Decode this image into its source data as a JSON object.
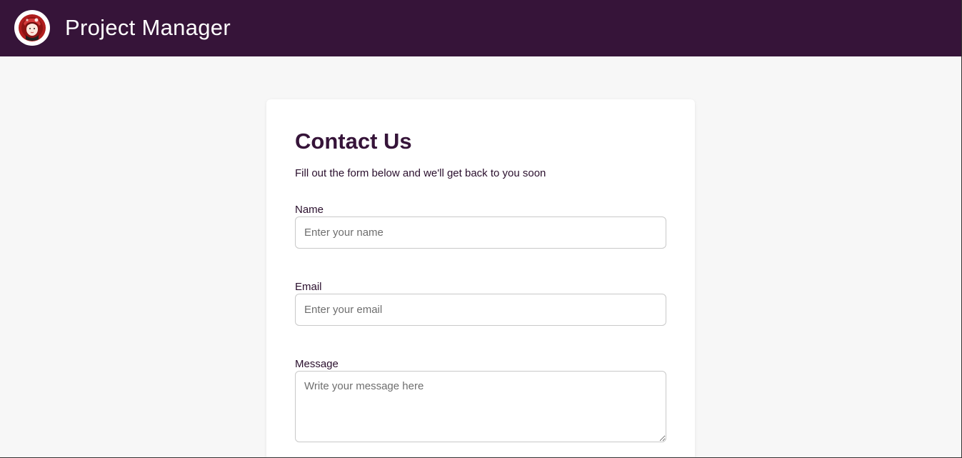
{
  "header": {
    "app_title": "Project Manager",
    "logo_icon": "avatar-logo-icon",
    "background_color": "#361439"
  },
  "contact_form": {
    "title": "Contact Us",
    "subtitle": "Fill out the form below and we'll get back to you soon",
    "fields": {
      "name": {
        "label": "Name",
        "placeholder": "Enter your name",
        "value": ""
      },
      "email": {
        "label": "Email",
        "placeholder": "Enter your email",
        "value": ""
      },
      "message": {
        "label": "Message",
        "placeholder": "Write your message here",
        "value": ""
      }
    },
    "accent_color": "#361439"
  }
}
